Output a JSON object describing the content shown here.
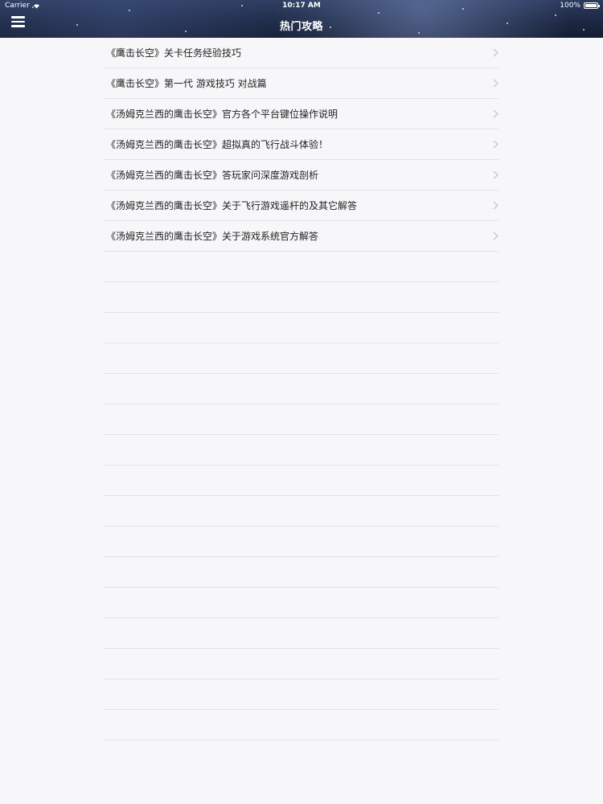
{
  "status_bar": {
    "carrier": "Carrier",
    "time": "10:17 AM",
    "battery": "100%"
  },
  "nav": {
    "title": "热门攻略",
    "menu_icon": "hamburger-menu-icon"
  },
  "colors": {
    "header_background": "#1c2742",
    "page_background": "#f7f7f9",
    "separator": "#e3e3e8",
    "chevron": "#c7c7cc"
  },
  "list": {
    "items": [
      {
        "label": "《鹰击长空》关卡任务经验技巧"
      },
      {
        "label": "《鹰击长空》第一代 游戏技巧 对战篇"
      },
      {
        "label": "《汤姆克兰西的鹰击长空》官方各个平台键位操作说明"
      },
      {
        "label": "《汤姆克兰西的鹰击长空》超拟真的飞行战斗体验！"
      },
      {
        "label": "《汤姆克兰西的鹰击长空》答玩家问深度游戏剖析"
      },
      {
        "label": "《汤姆克兰西的鹰击长空》关于飞行游戏遥杆的及其它解答"
      },
      {
        "label": "《汤姆克兰西的鹰击长空》关于游戏系统官方解答"
      }
    ],
    "chevron_icon": "chevron-right-icon"
  }
}
